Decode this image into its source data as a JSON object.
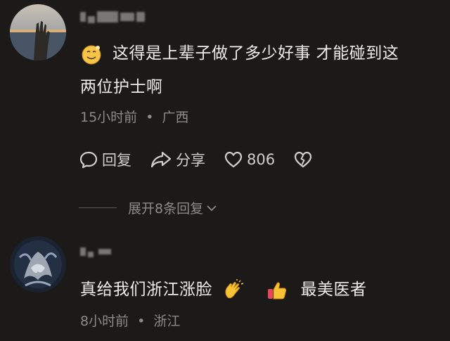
{
  "comments": [
    {
      "text_line1": "这得是上辈子做了多少好事 才能碰到这",
      "text_line2": "两位护士啊",
      "time": "15小时前",
      "location": "广西",
      "reply_label": "回复",
      "share_label": "分享",
      "like_count": "806",
      "expand_label": "展开8条回复"
    },
    {
      "text_part1": "真给我们浙江涨脸",
      "text_part2": "最美医者",
      "time": "8小时前",
      "location": "浙江"
    }
  ],
  "meta_separator": "•",
  "colors": {
    "background": "#1c1a19",
    "text": "#efedea",
    "meta": "#8d8a87"
  },
  "icons": [
    "smiley-emoji-icon",
    "comment-icon",
    "share-icon",
    "heart-icon",
    "broken-heart-icon",
    "chevron-down-icon",
    "clap-emoji-icon",
    "thumbs-up-emoji-icon"
  ]
}
